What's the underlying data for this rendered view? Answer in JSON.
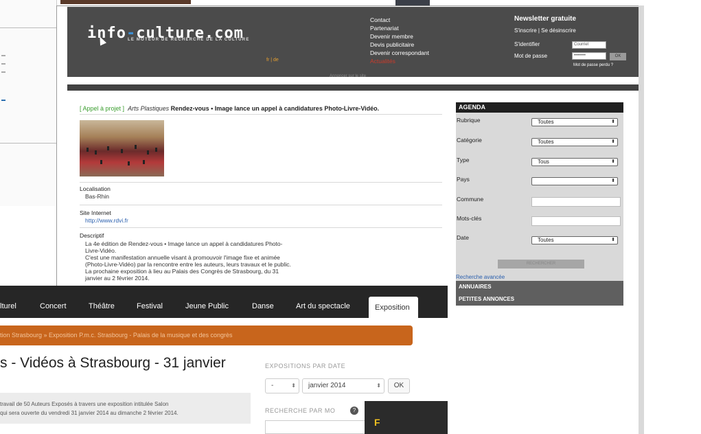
{
  "header": {
    "logo_main": "info",
    "logo_dash": "-",
    "logo_end": "culture.com",
    "tagline": "LE MOTEUR DE RECHERCHE DE LA CULTURE",
    "lang": "fr | de",
    "nav_links": [
      "Contact",
      "Partenariat",
      "Devenir membre",
      "Devis publicitaire",
      "Devenir correspondant",
      "Actualités"
    ],
    "subline": "Annoncer sur le site"
  },
  "newsletter": {
    "title": "Newsletter gratuite",
    "subtitle": "S'inscrire | Se désinscrire",
    "login_label": "S'identifier",
    "login_value": "Courriel",
    "password_label": "Mot de passe",
    "password_value": "••••••••",
    "ok": "OK",
    "forgot": "Mot de passe perdu ?"
  },
  "article": {
    "tag": "[ Appel à projet ]",
    "category": "Arts Plastiques",
    "headline": "Rendez-vous • Image lance un appel à candidatures Photo-Livre-Vidéo.",
    "location_label": "Localisation",
    "location_value": "Bas-Rhin",
    "site_label": "Site Internet",
    "site_value": "http://www.rdvi.fr",
    "description_label": "Descriptif",
    "description_lines": [
      "La 4e édition de Rendez-vous • Image lance un appel à candidatures Photo-",
      "Livre-Vidéo.",
      "C'est une manifestation annuelle visant à promouvoir l'image fixe et animée",
      "(Photo-Livre-Vidéo) par la rencontre entre les auteurs, leurs travaux et le public.",
      "La prochaine exposition à lieu au Palais des Congrès de Strasbourg, du 31",
      "janvier au 2 février 2014."
    ]
  },
  "agenda": {
    "title": "AGENDA",
    "fields": [
      {
        "label": "Rubrique",
        "value": "Toutes"
      },
      {
        "label": "Catégorie",
        "value": "Toutes"
      },
      {
        "label": "Type",
        "value": "Tous"
      },
      {
        "label": "Pays",
        "value": ""
      }
    ],
    "commune_label": "Commune",
    "keywords_label": "Mots-clés",
    "date_label": "Date",
    "date_value": "Toutes",
    "search_button": "RECHERCHER",
    "advanced": "Recherche avancée",
    "annuaires": "ANNUAIRES",
    "petites_annonces": "PETITES ANNONCES"
  },
  "overlay": {
    "nav": [
      "lturel",
      "Concert",
      "Théâtre",
      "Festival",
      "Jeune Public",
      "Danse",
      "Art du spectacle"
    ],
    "active_tab": "Exposition",
    "breadcrumb": "tion Strasbourg » Exposition P.m.c. Strasbourg - Palais de la musique et des congrès",
    "title": "s - Vidéos à Strasbourg - 31 janvier",
    "box_line1": "travail de 50 Auteurs Exposés à travers une exposition intitulée Salon",
    "box_line2": "qui sera ouverte du vendredi 31 janvier 2014 au dimanche 2 février 2014.",
    "expo_heading": "EXPOSITIONS PAR DATE",
    "day_value": "-",
    "month_value": "janvier 2014",
    "ok": "OK",
    "search_heading": "RECHERCHE PAR MO",
    "badge": "?",
    "dark_letter": "F"
  }
}
